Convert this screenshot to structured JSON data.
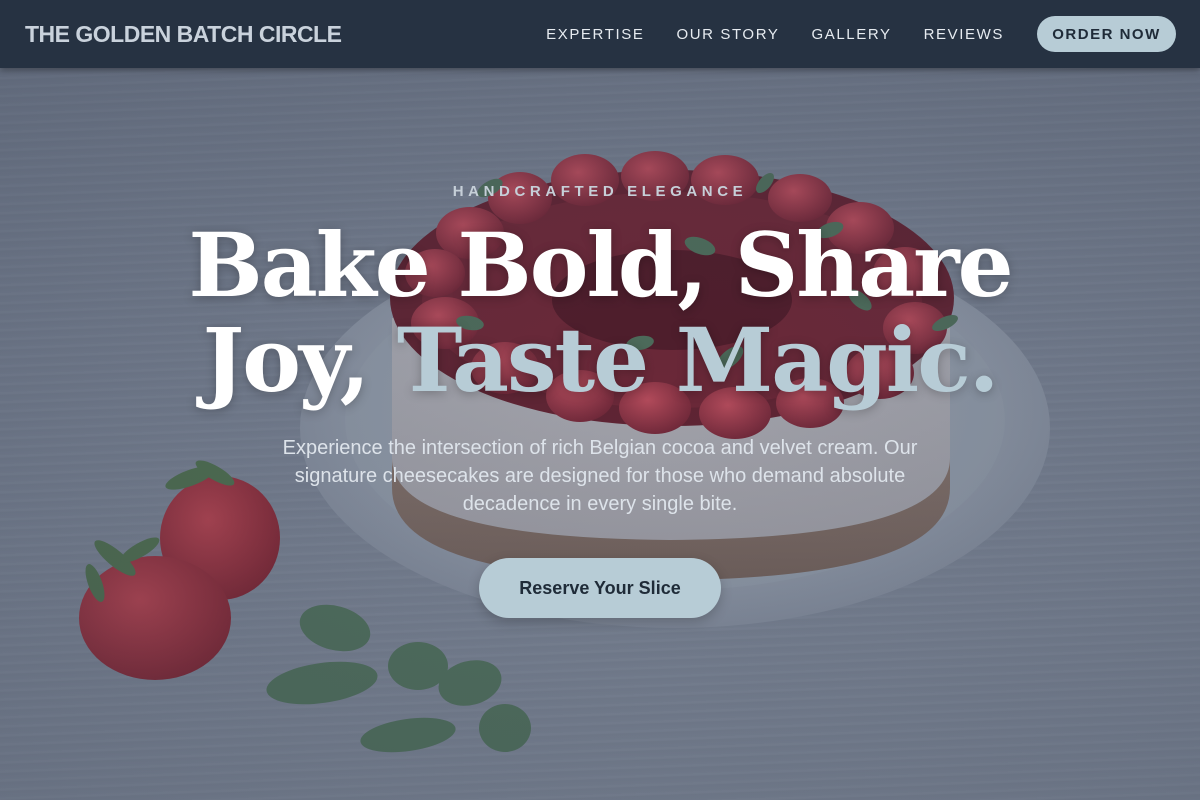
{
  "header": {
    "brand": "THE GOLDEN BATCH CIRCLE",
    "nav": [
      {
        "label": "EXPERTISE"
      },
      {
        "label": "OUR STORY"
      },
      {
        "label": "GALLERY"
      },
      {
        "label": "REVIEWS"
      }
    ],
    "order_label": "ORDER NOW"
  },
  "hero": {
    "eyebrow": "HANDCRAFTED ELEGANCE",
    "headline_line1": "Bake Bold, Share",
    "headline_line2_plain": "Joy, ",
    "headline_line2_accent": "Taste Magic.",
    "subtext": "Experience the intersection of rich Belgian cocoa and velvet cream. Our signature cheesecakes are designed for those who demand absolute decadence in every single bite.",
    "cta_label": "Reserve Your Slice",
    "background_subject": "strawberry-cheesecake-photo"
  },
  "colors": {
    "header_bg": "#263242",
    "accent": "#b7ccd6",
    "text_dark": "#1f2b38"
  }
}
